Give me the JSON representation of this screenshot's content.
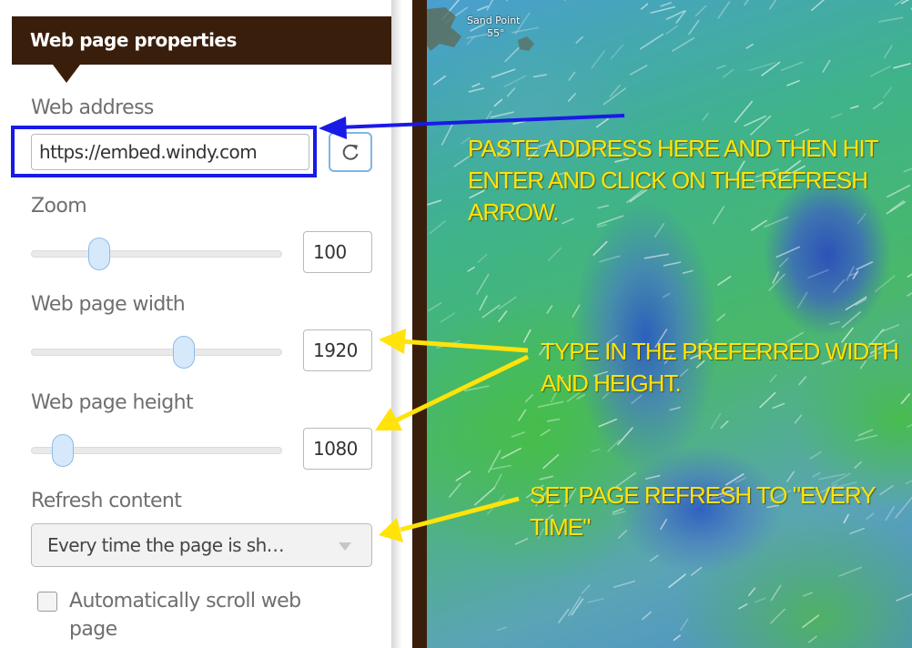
{
  "panel": {
    "title": "Web page properties",
    "web_address_label": "Web address",
    "web_address_value": "https://embed.windy.com",
    "refresh_button_icon": "refresh-icon",
    "zoom_label": "Zoom",
    "zoom_value": "100",
    "zoom_level": 0.25,
    "width_label": "Web page width",
    "width_value": "1920",
    "width_level": 0.62,
    "height_label": "Web page height",
    "height_value": "1080",
    "height_level": 0.09,
    "refresh_label": "Refresh content",
    "refresh_selected": "Every time the page is sh…",
    "autoscroll_label": "Automatically scroll web page",
    "autoscroll_checked": false
  },
  "map": {
    "place_name": "Sand Point",
    "place_value": "55°"
  },
  "annotations": {
    "paste_address": "PASTE ADDRESS HERE AND THEN HIT ENTER AND CLICK ON THE REFRESH ARROW.",
    "size": "TYPE IN THE PREFERRED WIDTH AND HEIGHT.",
    "refresh": "SET PAGE REFRESH TO \"EVERY TIME\""
  },
  "colors": {
    "header_bg": "#3a1e0c",
    "highlight_box": "#1a1ae6",
    "annotation_text": "#ffe30a",
    "arrow_blue": "#1a1ae6",
    "arrow_yellow": "#ffe30a"
  }
}
